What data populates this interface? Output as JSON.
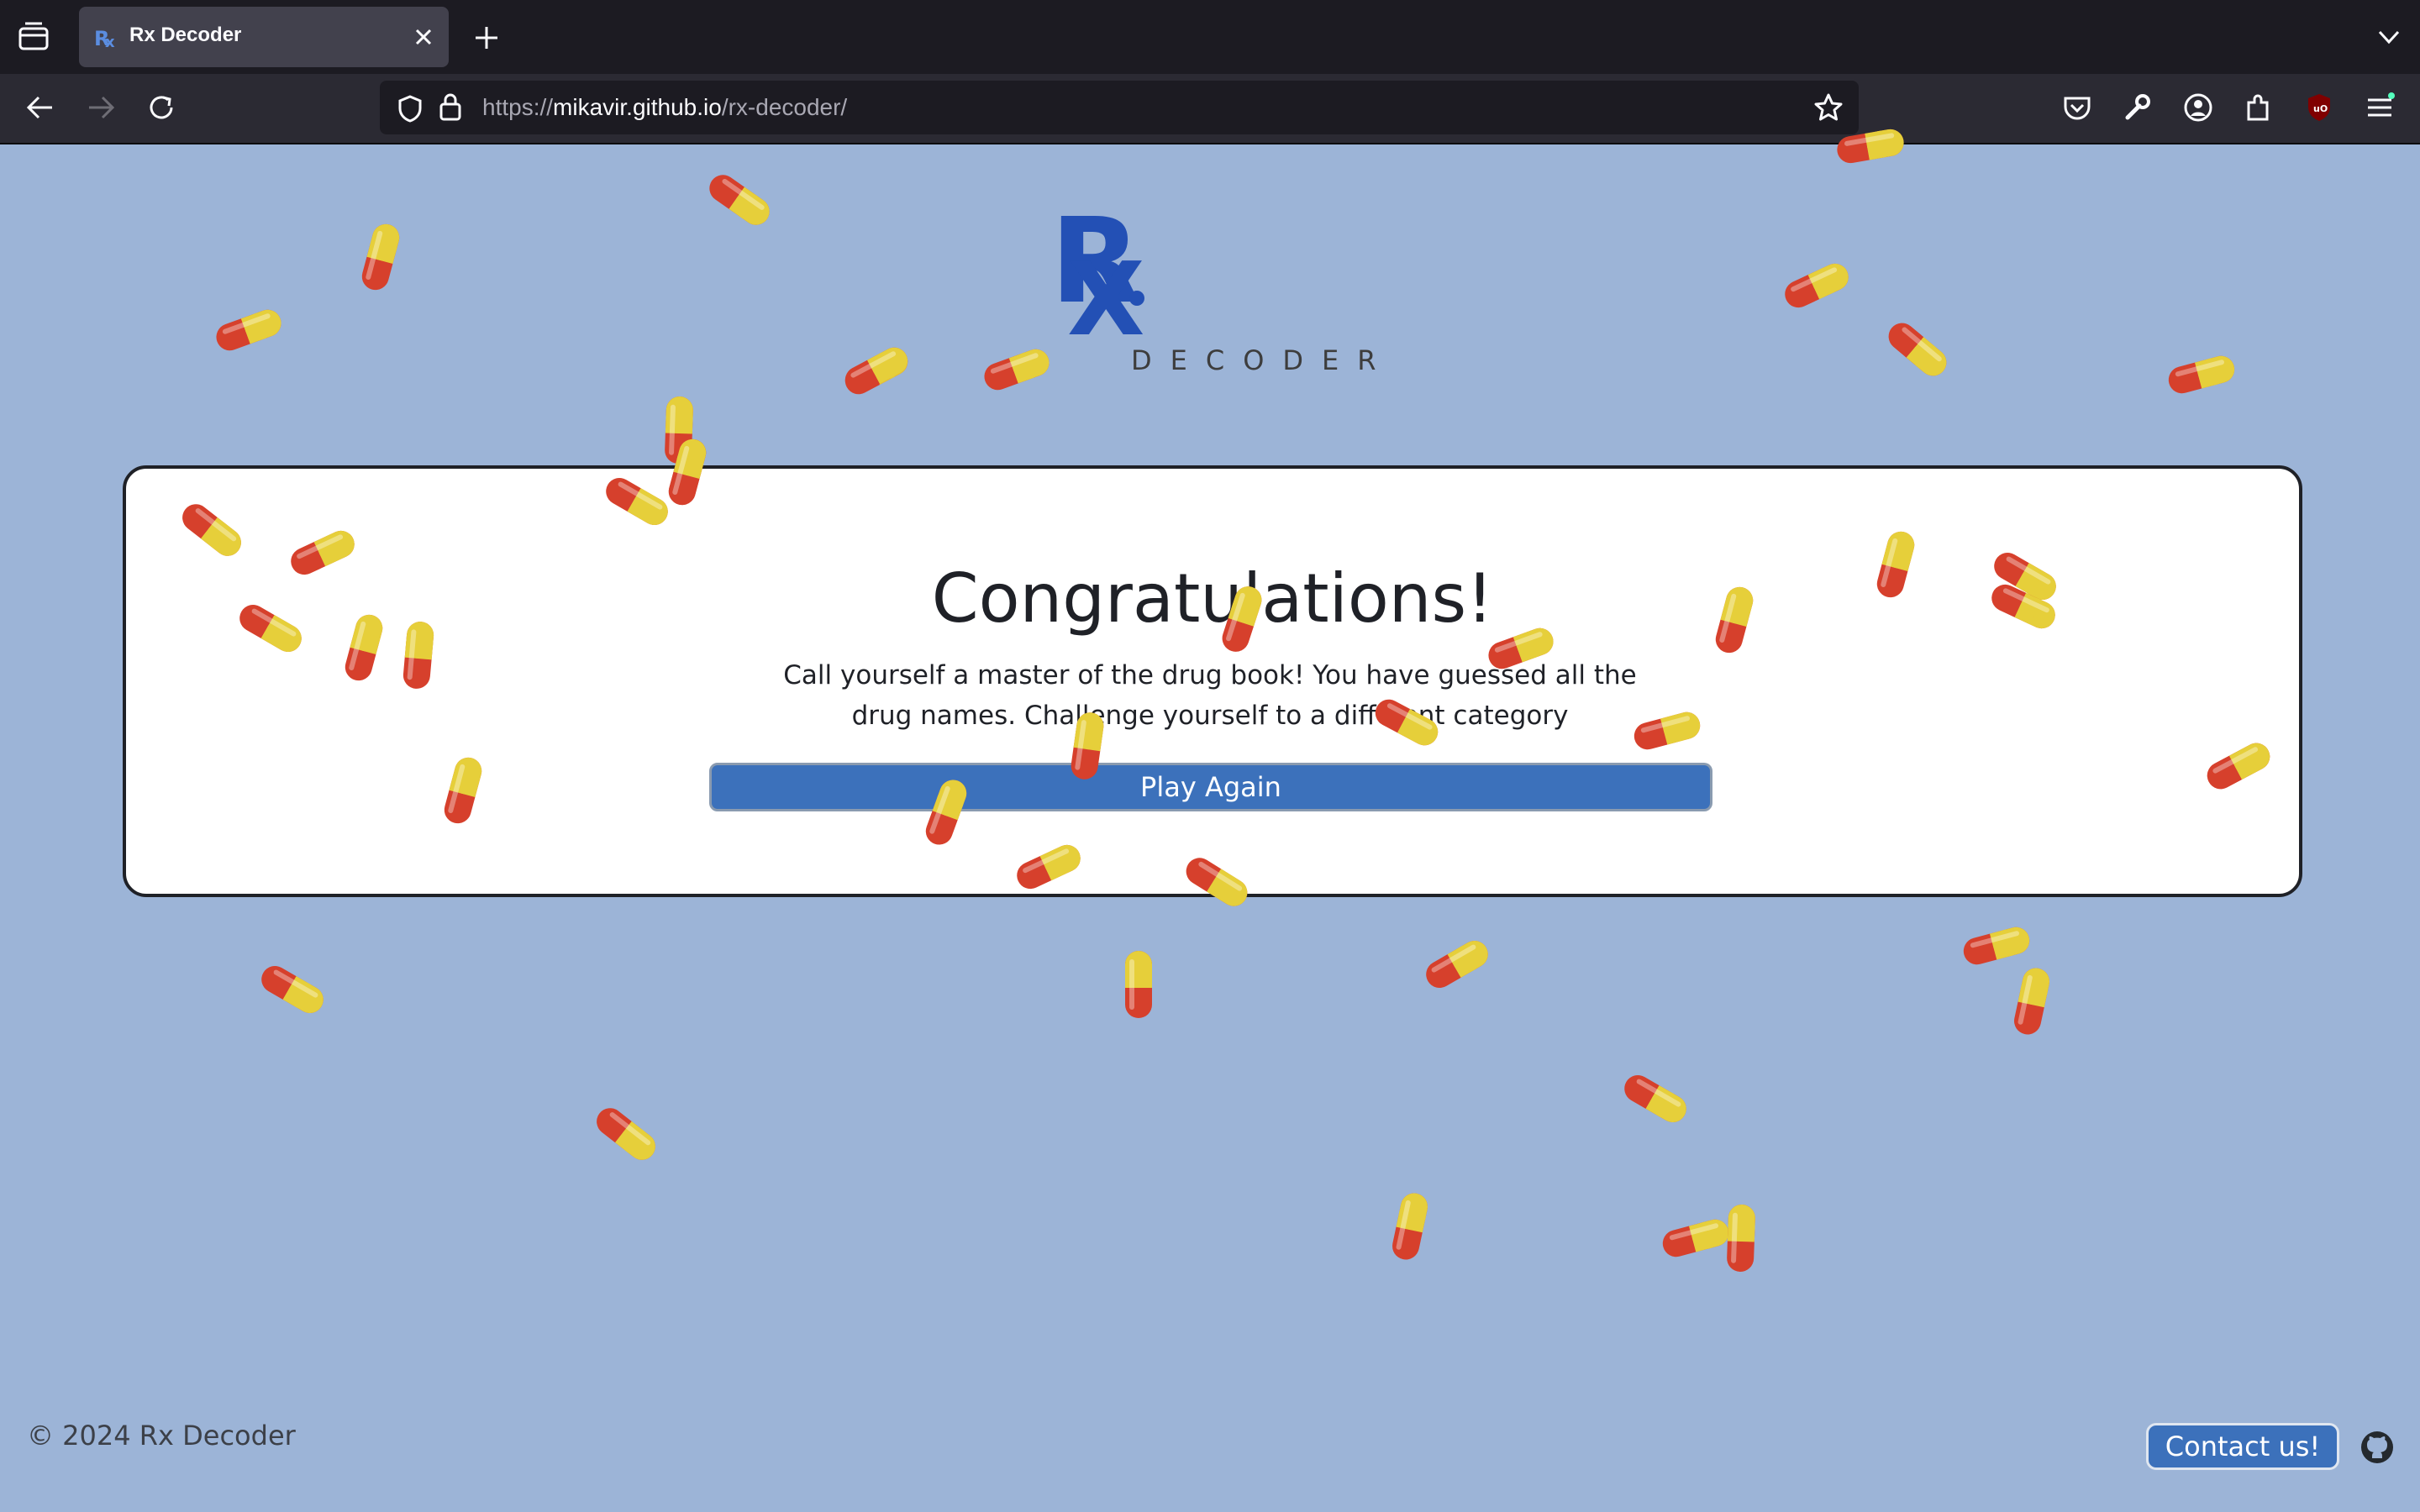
{
  "browser": {
    "tab_title": "Rx Decoder",
    "url_scheme": "https://",
    "url_host": "mikavir.github.io",
    "url_path": "/rx-decoder/",
    "icons": [
      "tab-list-icon",
      "close-icon",
      "plus-icon",
      "chevron-down-icon",
      "back-icon",
      "forward-icon",
      "reload-icon",
      "shield-icon",
      "lock-icon",
      "star-icon",
      "pocket-icon",
      "wrench-icon",
      "account-icon",
      "extensions-icon",
      "ublock-icon",
      "menu-icon"
    ]
  },
  "logo": {
    "letter_r": "R",
    "letter_x": "X",
    "word": "DECODER"
  },
  "card": {
    "title": "Congratulations!",
    "message": "Call yourself a master of the drug book! You have guessed all the drug names. Challenge yourself to a different category",
    "play_again_label": "Play Again"
  },
  "footer": {
    "copyright": "© 2024 Rx Decoder",
    "contact_label": "Contact us!",
    "github_icon": "github-icon"
  },
  "colors": {
    "page_bg": "#9cb4d7",
    "brand_blue": "#2350b5",
    "button_blue": "#3c71bb",
    "pill_red": "#d6402c",
    "pill_yellow": "#e6cf3a"
  },
  "confetti": {
    "pill_icon": "capsule-icon",
    "count": 44
  }
}
